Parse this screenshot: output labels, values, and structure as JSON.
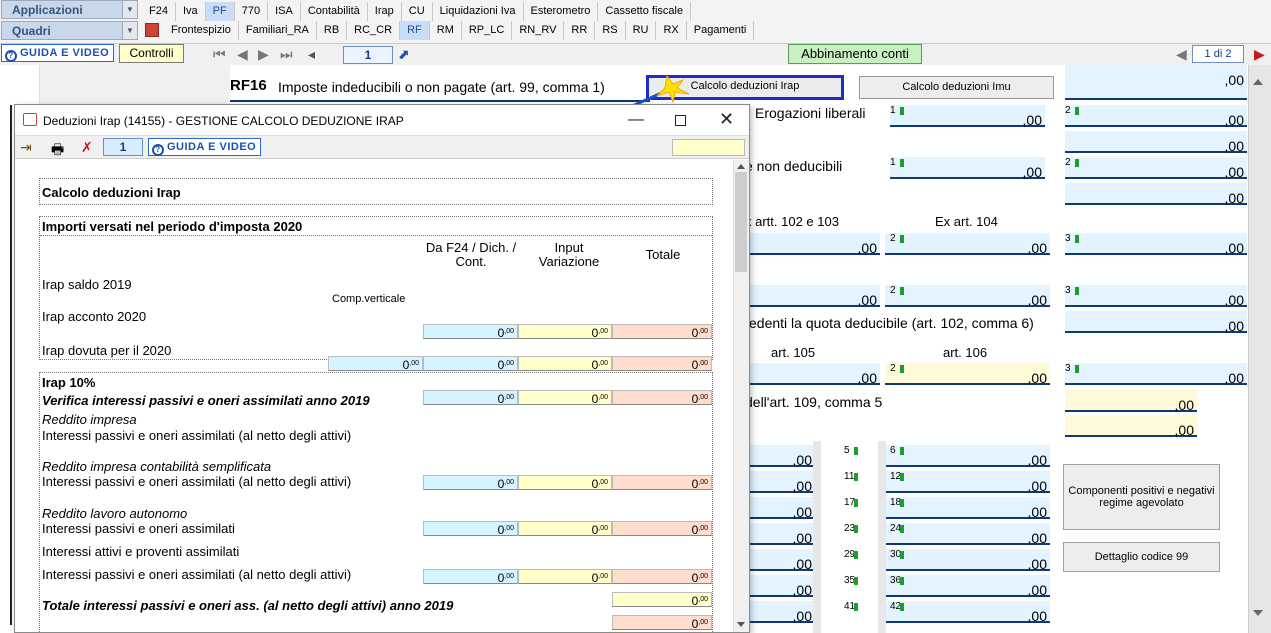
{
  "topbar": {
    "applicazioni": "Applicazioni",
    "quadri": "Quadri",
    "tabs1": [
      {
        "label": "F24"
      },
      {
        "label": "Iva"
      },
      {
        "label": "PF",
        "active": true
      },
      {
        "label": "770"
      },
      {
        "label": "ISA"
      },
      {
        "label": "Contabilità"
      },
      {
        "label": "Irap"
      },
      {
        "label": "CU"
      },
      {
        "label": "Liquidazioni Iva"
      },
      {
        "label": "Esterometro"
      },
      {
        "label": "Cassetto fiscale"
      }
    ],
    "tabs2": [
      {
        "label": "Frontespizio"
      },
      {
        "label": "Familiari_RA"
      },
      {
        "label": "RB"
      },
      {
        "label": "RC_CR"
      },
      {
        "label": "RF",
        "active": true
      },
      {
        "label": "RM"
      },
      {
        "label": "RP_LC"
      },
      {
        "label": "RN_RV"
      },
      {
        "label": "RR"
      },
      {
        "label": "RS"
      },
      {
        "label": "RU"
      },
      {
        "label": "RX"
      },
      {
        "label": "Pagamenti"
      }
    ]
  },
  "toolbar": {
    "guida": "GUIDA E VIDEO",
    "controlli": "Controlli",
    "page": "1",
    "abbinamento": "Abbinamento conti",
    "page_of": "1 di 2"
  },
  "rf": {
    "row_code": "RF16",
    "row_label": "Imposte indeducibili o non pagate (art. 99, comma 1)",
    "btn_irap": "Calcolo deduzioni Irap",
    "btn_imu": "Calcolo deduzioni Imu",
    "erogazioni": "Erogazioni liberali",
    "non_deducibili": "e non deducibili",
    "art102": "x artt. 102 e 103",
    "art104": "Ex art. 104",
    "eccedenti": "cedenti la quota deducibile (art. 102, comma 6)",
    "art105": "art. 105",
    "art106": "art. 106",
    "art109": "dell'art. 109, comma 5",
    "btn_componenti": "Componenti positivi e negativi regime agevolato",
    "btn_dettaglio": "Dettaglio codice 99",
    "zero": ",00",
    "nums": [
      "1",
      "2",
      "1",
      "2",
      "2",
      "3",
      "2",
      "3",
      "2",
      "3",
      "5",
      "6",
      "11",
      "12",
      "17",
      "18",
      "23",
      "24",
      "29",
      "30",
      "35",
      "36",
      "41",
      "42"
    ]
  },
  "dialog": {
    "title": "Deduzioni Irap (14155) - GESTIONE CALCOLO DEDUZIONE IRAP",
    "page": "1",
    "guida": "GUIDA E VIDEO",
    "sec_title": "Calcolo deduzioni Irap",
    "importi_title": "Importi versati nel periodo d'imposta 2020",
    "col1": "Da F24 / Dich. / Cont.",
    "col2": "Input Variazione",
    "col3": "Totale",
    "irap_saldo": "Irap saldo 2019",
    "comp_verticale": "Comp.verticale",
    "irap_acconto": "Irap acconto 2020",
    "irap_dovuta": "Irap dovuta per il 2020",
    "irap10": "Irap 10%",
    "verifica": "Verifica interessi passivi e oneri assimilati anno 2019",
    "reddito_impresa": "Reddito impresa",
    "int_netto": "Interessi passivi e oneri assimilati (al netto degli attivi)",
    "reddito_semplificata": "Reddito impresa contabilità semplificata",
    "reddito_autonomo": "Reddito lavoro autonomo",
    "int_passivi": "Interessi passivi e oneri assimilati",
    "int_attivi": "Interessi attivi e proventi assimilati",
    "totale_int": "Totale interessi passivi e oneri ass. (al netto degli attivi) anno 2019",
    "zero": "0",
    "dec": ",00"
  },
  "colors": {
    "accent": "#1b2ec8",
    "cyan_field": "#d4f4ff",
    "yellow_field": "#ffffcc",
    "salmon_field": "#ffdccc"
  }
}
